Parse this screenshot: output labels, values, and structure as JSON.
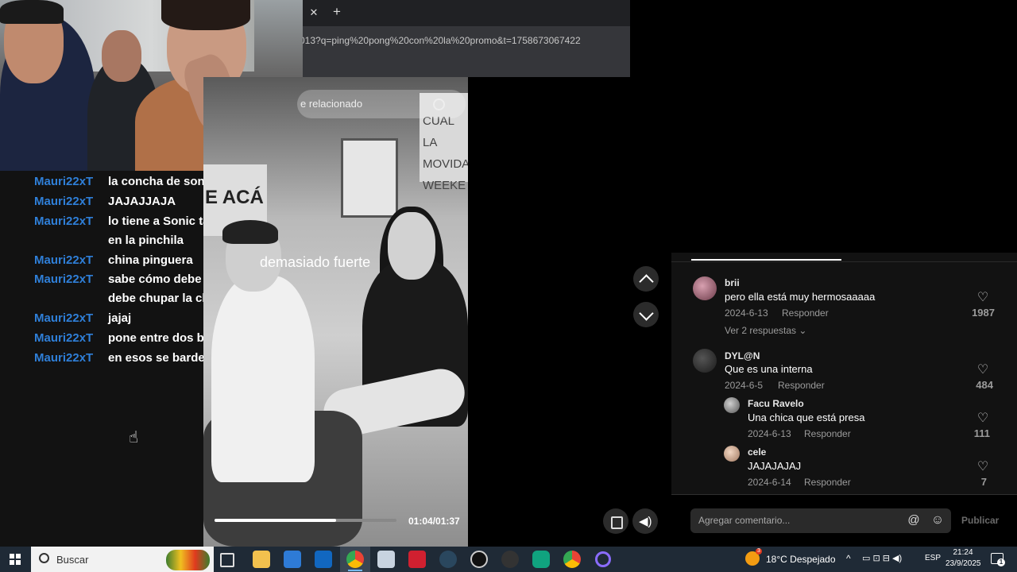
{
  "browser": {
    "close_glyph": "✕",
    "new_tab_glyph": "+",
    "url": "013?q=ping%20pong%20con%20la%20promo&t=1758673067422"
  },
  "chat": {
    "messages": [
      {
        "user": "Mauri22xT",
        "text": "la concha de sonic"
      },
      {
        "user": "Mauri22xT",
        "text": "JAJAJJAJA"
      },
      {
        "user": "Mauri22xT",
        "text": "lo tiene a Sonic tatuado",
        "text2": "en la pinchila"
      },
      {
        "user": "Mauri22xT",
        "text": "china pinguera"
      },
      {
        "user": "Mauri22xT",
        "text": "sabe cómo debe cómo la",
        "text2": "debe chupar la china"
      },
      {
        "user": "Mauri22xT",
        "text": "jajaj"
      },
      {
        "user": "Mauri22xT",
        "text": "pone entre dos bancos"
      },
      {
        "user": "Mauri22xT",
        "text": "en esos se bardean"
      }
    ],
    "user_color": "#2f7fd8"
  },
  "video": {
    "search_text": "e relacionado",
    "board_text": "CUAL LA MOVIDA WEEKE",
    "wall_text": "E ACÁ",
    "overlay_text": "demasiado fuerte",
    "time": "01:04/01:37",
    "progress": 0.67
  },
  "comments": [
    {
      "user": "brii",
      "text": "pero ella está muy hermosaaaaa",
      "date": "2024-6-13",
      "reply": "Responder",
      "likes": "1987",
      "more": "Ver 2 respuestas ⌄"
    },
    {
      "user": "DYL@N",
      "text": "Que es una interna",
      "date": "2024-6-5",
      "reply": "Responder",
      "likes": "484"
    },
    {
      "user": "Facu Ravelo",
      "text": "Una chica que está presa",
      "date": "2024-6-13",
      "reply": "Responder",
      "likes": "111"
    },
    {
      "user": "cele",
      "text": "JAJAJAJAJ",
      "date": "2024-6-14",
      "reply": "Responder",
      "likes": "7"
    }
  ],
  "comment_box": {
    "placeholder": "Agregar comentario...",
    "at_glyph": "@",
    "emoji_glyph": "☺",
    "publish": "Publicar"
  },
  "taskbar": {
    "search": "Buscar",
    "weather": "18°C  Despejado",
    "weather_badge": "3",
    "lang": "ESP",
    "time": "21:24",
    "date": "23/9/2025",
    "notif_badge": "1",
    "tray_up": "^",
    "tray_glyphs": "▭ ⊡ ⊟ ◀)"
  },
  "icons": {
    "heart": "♡",
    "volume": "◀)",
    "cursor": "☝"
  }
}
